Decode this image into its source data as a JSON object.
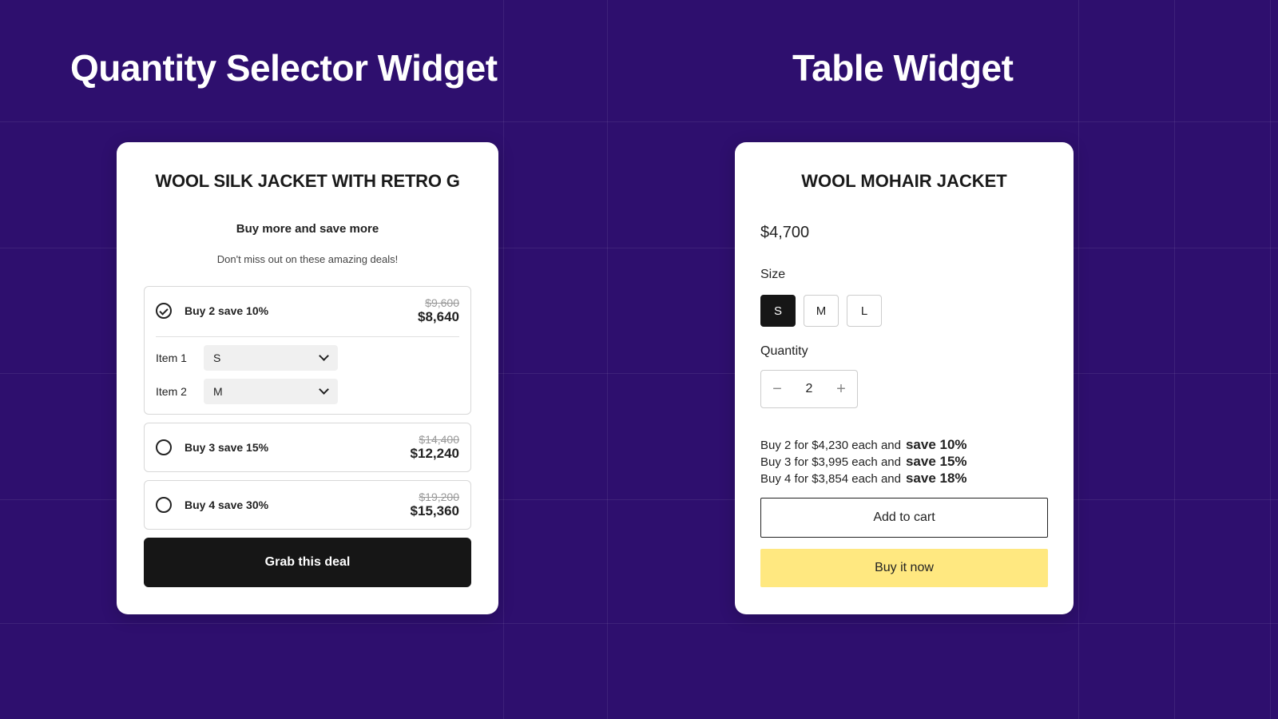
{
  "headings": {
    "left": "Quantity Selector Widget",
    "right": "Table Widget"
  },
  "leftCard": {
    "productTitle": "WOOL SILK JACKET WITH RETRO G",
    "subtitle": "Buy more and save more",
    "tagline": "Don't miss out on these amazing deals!",
    "tiers": [
      {
        "label": "Buy 2 save 10%",
        "oldPrice": "$9,600",
        "newPrice": "$8,640",
        "selected": true
      },
      {
        "label": "Buy 3 save 15%",
        "oldPrice": "$14,400",
        "newPrice": "$12,240",
        "selected": false
      },
      {
        "label": "Buy 4 save 30%",
        "oldPrice": "$19,200",
        "newPrice": "$15,360",
        "selected": false
      }
    ],
    "items": [
      {
        "label": "Item 1",
        "value": "S"
      },
      {
        "label": "Item 2",
        "value": "M"
      }
    ],
    "cta": "Grab this deal"
  },
  "rightCard": {
    "productTitle": "WOOL MOHAIR JACKET",
    "price": "$4,700",
    "sizeLabel": "Size",
    "sizes": [
      {
        "label": "S",
        "active": true
      },
      {
        "label": "M",
        "active": false
      },
      {
        "label": "L",
        "active": false
      }
    ],
    "qtyLabel": "Quantity",
    "qtyValue": "2",
    "offers": [
      {
        "text": "Buy 2 for $4,230 each and",
        "save": "save 10%"
      },
      {
        "text": "Buy 3 for $3,995 each and",
        "save": "save 15%"
      },
      {
        "text": "Buy 4 for $3,854 each and",
        "save": "save 18%"
      }
    ],
    "addToCart": "Add to cart",
    "buyNow": "Buy it now"
  }
}
